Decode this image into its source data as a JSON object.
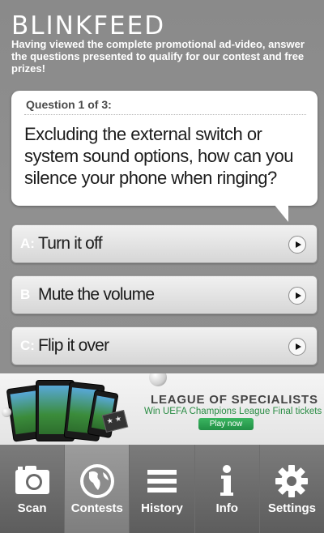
{
  "header": {
    "brand": "BLINKFEED",
    "intro": "Having viewed the complete promotional ad-video, answer the questions presented to qualify for our contest and free prizes!"
  },
  "question": {
    "counter": "Question 1 of 3:",
    "text": "Excluding the external switch or system sound options, how can you silence your phone when ringing?"
  },
  "answers": [
    {
      "letter": "A:",
      "text": "Turn it off"
    },
    {
      "letter": "B",
      "text": "Mute the volume"
    },
    {
      "letter": "C:",
      "text": "Flip it over"
    }
  ],
  "banner": {
    "title": "LEAGUE OF SPECIALISTS",
    "subtitle": "Win UEFA Champions League Final tickets",
    "button": "Play now"
  },
  "tabs": [
    {
      "label": "Scan",
      "icon": "camera-icon",
      "active": false
    },
    {
      "label": "Contests",
      "icon": "globe-icon",
      "active": true
    },
    {
      "label": "History",
      "icon": "list-icon",
      "active": false
    },
    {
      "label": "Info",
      "icon": "info-icon",
      "active": false
    },
    {
      "label": "Settings",
      "icon": "gear-icon",
      "active": false
    }
  ],
  "colors": {
    "background": "#8a8a8a",
    "bubble": "#ffffff",
    "tabbar": "#6a6a6a",
    "ad_accent": "#2a8c44"
  }
}
